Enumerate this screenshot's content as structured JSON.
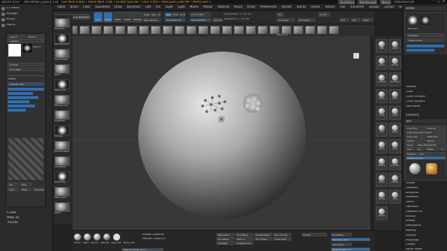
{
  "titlebar": {
    "left": "ZBrush 2023",
    "doc": "ZBrushMain_Layout_128",
    "stats": "Free Mem 9.8GB • Active Mem 154K • Scratch Disk 48 • Timer 0.059 • PolyCount 2.000 MP • MeshCount 1",
    "right_quicksave": "QuickSave",
    "right_seethrough": "See-through 0",
    "right_menus": "Menus",
    "right_script": "DefaultZScript"
  },
  "menubar": {
    "items": [
      "Alpha",
      "Brush",
      "Color",
      "Document",
      "Draw",
      "Dynamics",
      "Edit",
      "File",
      "Layer",
      "Light",
      "Macro",
      "Marker",
      "Material",
      "Movie",
      "Picker",
      "Preferences",
      "Render",
      "Stencil",
      "Stroke",
      "Texture",
      "Tool",
      "Transform",
      "Zplugin",
      "Zscript",
      "Help"
    ],
    "coords": "0.107,0.513,-0.844"
  },
  "toolbar": {
    "lightbox": "LightBox",
    "liveboolean": "Live Boolean",
    "edit": "Edit",
    "draw": "Draw",
    "move": "Move",
    "scale": "Scale",
    "rotate": "Rotate",
    "mrgb": "Mrgb",
    "rgb": "Rgb",
    "m": "M",
    "zadd": "Zadd",
    "zsub": "Zsub",
    "zcut": "Zcut",
    "rgb_intensity": "Rgb Intensity",
    "z_intensity": "Z Intensity 25",
    "focal_shift": "Focal Shift 0",
    "draw_size": "Draw Size 64",
    "dynamic": "Dynamic",
    "active_points": "ActivePoints: 2,785 Mil",
    "total_points": "TotalPoints: 2,785 Mil",
    "shelf_label": "Pencil_01",
    "dim": "Dim",
    "del_lower": "Del Lower",
    "del_higher": "Del Higher",
    "smt": "Smt",
    "suv": "SUV",
    "reuv": "ReUV",
    "divide": "Divide"
  },
  "left": {
    "menus": [
      "13 Menu",
      "Zplugin",
      "Brush",
      "Alpha"
    ],
    "import": "Import",
    "export": "Export",
    "lightbox": "LightBox",
    "alpha": "Alpha",
    "alpha_label": "Alpha 0",
    "tomesh": "To Mesh",
    "fromm": "From Mesh",
    "modify": "Modify",
    "intensity": "Intensity 100",
    "tile": "Tile",
    "hide": "Hide",
    "copy": "Copy",
    "paste": "Paste",
    "seamless": "Seamless",
    "create": "Create",
    "make3d": "Make 3D",
    "transfer": "Transfer",
    "thumb_labels": [
      "Standard",
      "DamStandard",
      "Clay Buildup",
      "Move",
      "Texture Off",
      "MatCap Gray",
      "ClayPolish",
      "Extrude",
      "Extrude Blend",
      "TPoseMesh",
      "Gizmo Rig",
      "TPose SubT",
      "XPose"
    ]
  },
  "viewport": {
    "dots_label": "Dots"
  },
  "rightshelf": {
    "labels": [
      "BPR",
      "Scroll",
      "Zoom",
      "Actual",
      "AAHalf",
      "Dynamic",
      "Persp",
      "Floor",
      "Local",
      "L.Sym",
      "XYZ",
      "Frame",
      "Move",
      "Scale",
      "Rotate",
      "Line Fill",
      "PolyF",
      "Transp",
      "Ghost",
      "Solo",
      "Xpose"
    ]
  },
  "rightpanel": {
    "stroke": "Stroke",
    "brush_name": "Standard",
    "modifiers": "Modifiers",
    "replacement": "Replacement",
    "item_list": [
      "Samples",
      "Curve",
      "Curve Functions",
      "Curve Modifiers",
      "Lazy Mouse"
    ],
    "inventory": "Inventory",
    "tool": "Tool",
    "load_tool": "Load Tool",
    "save_as": "Save As",
    "load_project": "Load Tools From Project",
    "copy_tool": "Copy Tool",
    "paste_tool": "Paste Tool",
    "import": "Import",
    "export": "Export",
    "clone": "Clone",
    "make_polymesh": "Make PolyMesh3D",
    "goz": "GoZ",
    "all": "All",
    "visible": "Visible",
    "r": "R",
    "lightbox_tools": "Lightbox > Tools",
    "polysphere": "PolySphere_48",
    "sections": [
      "Subtool",
      "Geometry",
      "ArrayMesh",
      "NanoMesh",
      "Layers",
      "FiberMesh",
      "Geometry HD",
      "Preview",
      "Surface",
      "Deformation",
      "Masking",
      "Visibility",
      "Polygroups",
      "Contact",
      "Morph Target",
      "Polypaint",
      "UV Map",
      "Texture Map",
      "Displacement Map",
      "Normal Map",
      "Vector Displacement Map",
      "Display Properties",
      "Unified Skin",
      "Initialize",
      "Import",
      "Export"
    ]
  },
  "bottom": {
    "enable_customize": "Enable Customize",
    "restore_custom": "Restore Custom UI",
    "items": [
      "Stroke",
      "Alpha",
      "Texture",
      "Material",
      "Alpha Off",
      "Texture Off"
    ],
    "mask_by": "Mask By Polygroups 0",
    "zremesher": "ZRemesher",
    "sharpen_mask": "SharpenMask",
    "grow_mask": "GrowMask",
    "brushmask": "BrushMask",
    "auto_groups": "Auto Groups",
    "mask_all": "Mask All",
    "del_hidden": "Del Hidden",
    "close_holes": "Close Holes",
    "create_nl": "CreateNL",
    "unmasked_ctr": "UnMasked Ctr",
    "double": "Double",
    "dynamesh": "DynaMesh",
    "resolution": "Resolution 128",
    "zremesher_b": "ZRemesher",
    "target": "Target Polygons 5"
  },
  "colors": {
    "accent_orange": "#e08a2c",
    "accent_blue": "#2f6fb3",
    "viewport_bg": "#383838"
  }
}
